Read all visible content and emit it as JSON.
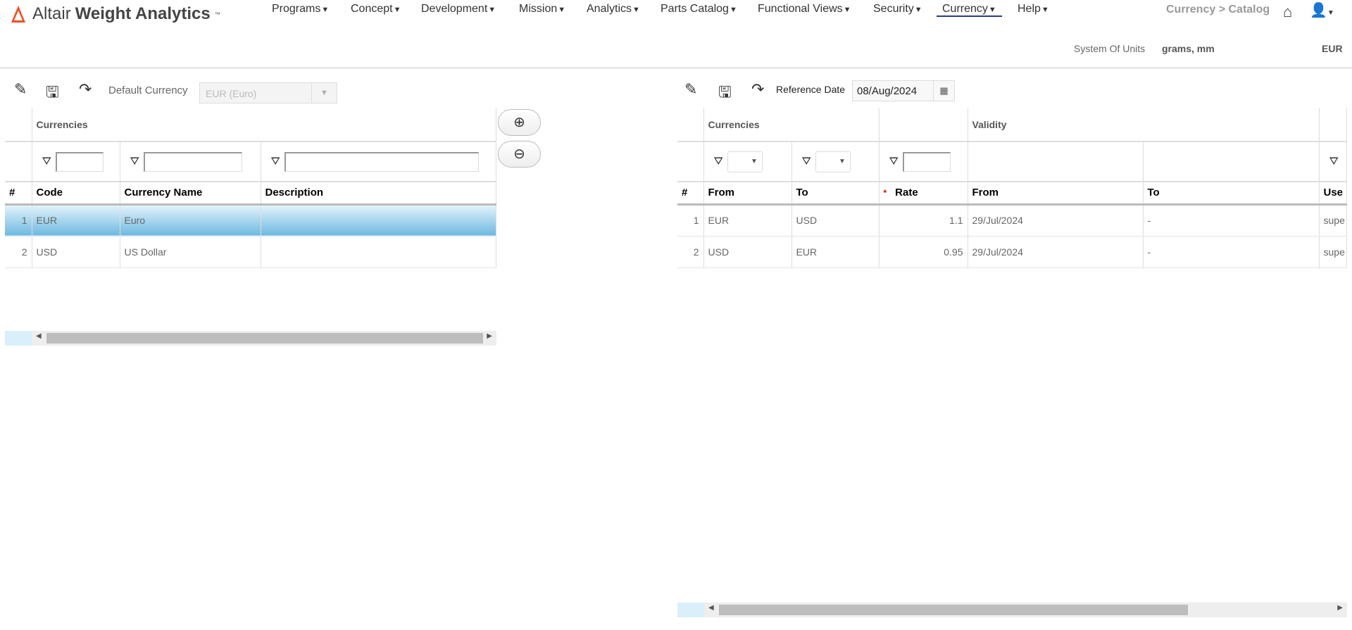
{
  "header": {
    "brand_prefix": "Altair",
    "brand_name": "Weight Analytics",
    "brand_tm": "™",
    "nav": [
      "Programs",
      "Concept",
      "Development",
      "Mission",
      "Analytics",
      "Parts Catalog",
      "Functional Views",
      "Security",
      "Currency",
      "Help"
    ],
    "active_nav": "Currency",
    "breadcrumb": "Currency > Catalog",
    "system_of_units_label": "System Of Units",
    "system_of_units_value": "grams, mm",
    "currency": "EUR"
  },
  "left": {
    "default_currency_label": "Default Currency",
    "default_currency_value": "EUR (Euro)",
    "group_header": "Currencies",
    "columns": [
      "#",
      "Code",
      "Currency Name",
      "Description"
    ],
    "rows": [
      {
        "n": "1",
        "code": "EUR",
        "name": "Euro",
        "desc": ""
      },
      {
        "n": "2",
        "code": "USD",
        "name": "US Dollar",
        "desc": ""
      }
    ],
    "add_icon": "⊕",
    "remove_icon": "⊖"
  },
  "right": {
    "reference_date_label": "Reference Date",
    "reference_date": "08/Aug/2024",
    "group_currencies": "Currencies",
    "group_validity": "Validity",
    "columns": [
      "#",
      "From",
      "To",
      "Rate",
      "From",
      "To",
      "Use"
    ],
    "required_mark": "*",
    "rows": [
      {
        "n": "1",
        "from": "EUR",
        "to": "USD",
        "rate": "1.1",
        "vfrom": "29/Jul/2024",
        "vto": "-",
        "user": "supe"
      },
      {
        "n": "2",
        "from": "USD",
        "to": "EUR",
        "rate": "0.95",
        "vfrom": "29/Jul/2024",
        "vto": "-",
        "user": "supe"
      }
    ]
  },
  "colors": {
    "brand": "#f04e23",
    "nav_underline": "#2a3a8c",
    "selected_row": "#6db9e0"
  }
}
